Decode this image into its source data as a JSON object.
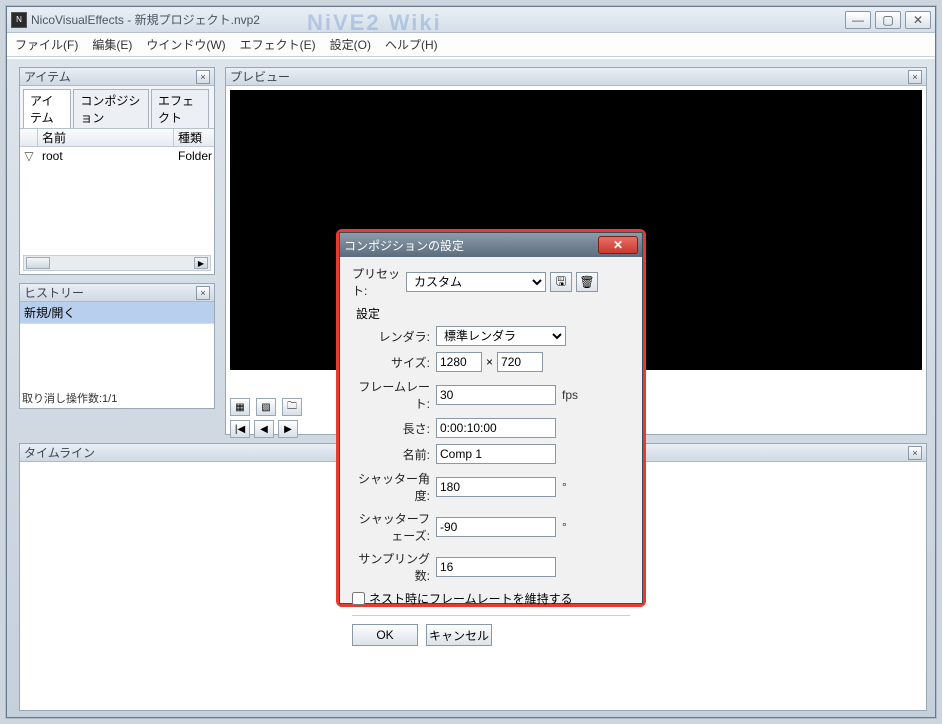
{
  "window": {
    "app_name": "NicoVisualEffects",
    "doc_name": "新規プロジェクト.nvp2",
    "watermark": "NiVE2 Wiki"
  },
  "menubar": {
    "file": "ファイル(F)",
    "edit": "編集(E)",
    "window": "ウインドウ(W)",
    "effect": "エフェクト(E)",
    "settings": "設定(O)",
    "help": "ヘルプ(H)"
  },
  "panels": {
    "items": {
      "title": "アイテム",
      "tabs": {
        "items": "アイテム",
        "composition": "コンポジション",
        "effect": "エフェクト"
      },
      "columns": {
        "name": "名前",
        "type": "種類"
      },
      "rows": [
        {
          "name": "root",
          "type": "Folder"
        }
      ]
    },
    "history": {
      "title": "ヒストリー",
      "entries": [
        "新規/開く"
      ],
      "undo_count": "取り消し操作数:1/1"
    },
    "preview": {
      "title": "プレビュー"
    },
    "timeline": {
      "title": "タイムライン"
    }
  },
  "dialog": {
    "title": "コンポジションの設定",
    "preset_label": "プリセット:",
    "preset_value": "カスタム",
    "settings_label": "設定",
    "renderer_label": "レンダラ:",
    "renderer_value": "標準レンダラ",
    "size_label": "サイズ:",
    "size_w": "1280",
    "size_h": "720",
    "size_sep": "×",
    "framerate_label": "フレームレート:",
    "framerate_value": "30",
    "framerate_unit": "fps",
    "length_label": "長さ:",
    "length_value": "0:00:10:00",
    "name_label": "名前:",
    "name_value": "Comp 1",
    "shutter_angle_label": "シャッター角度:",
    "shutter_angle_value": "180",
    "deg_unit": "°",
    "shutter_phase_label": "シャッターフェーズ:",
    "shutter_phase_value": "-90",
    "sampling_label": "サンプリング数:",
    "sampling_value": "16",
    "nest_keep_fps": "ネスト時にフレームレートを維持する",
    "ok": "OK",
    "cancel": "キャンセル"
  }
}
